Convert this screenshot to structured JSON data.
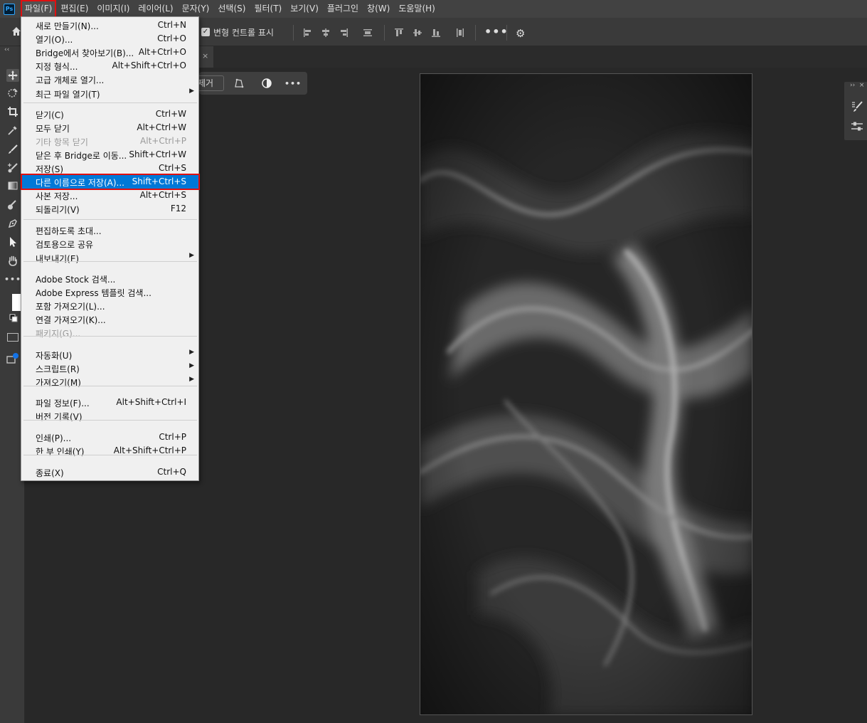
{
  "app": {
    "logo_text": "Ps"
  },
  "menubar": {
    "items": [
      {
        "label": "파일(F)"
      },
      {
        "label": "편집(E)"
      },
      {
        "label": "이미지(I)"
      },
      {
        "label": "레이어(L)"
      },
      {
        "label": "문자(Y)"
      },
      {
        "label": "선택(S)"
      },
      {
        "label": "필터(T)"
      },
      {
        "label": "보기(V)"
      },
      {
        "label": "플러그인"
      },
      {
        "label": "창(W)"
      },
      {
        "label": "도움말(H)"
      }
    ]
  },
  "optionsbar": {
    "transform_controls_label": "변형 컨트롤 표시",
    "transform_controls_checked": true,
    "more_icon": "ellipsis-icon",
    "settings_icon": "gear-icon"
  },
  "tab": {
    "close_glyph": "×"
  },
  "context_bar": {
    "remove_label": "제거"
  },
  "file_menu": {
    "items": [
      {
        "label": "새로 만들기(N)...",
        "shortcut": "Ctrl+N"
      },
      {
        "label": "열기(O)...",
        "shortcut": "Ctrl+O"
      },
      {
        "label": "Bridge에서 찾아보기(B)...",
        "shortcut": "Alt+Ctrl+O"
      },
      {
        "label": "지정 형식...",
        "shortcut": "Alt+Shift+Ctrl+O"
      },
      {
        "label": "고급 개체로 열기...",
        "shortcut": ""
      },
      {
        "label": "최근 파일 열기(T)",
        "shortcut": "",
        "submenu": true
      },
      {
        "label": "닫기(C)",
        "shortcut": "Ctrl+W"
      },
      {
        "label": "모두 닫기",
        "shortcut": "Alt+Ctrl+W"
      },
      {
        "label": "기타 항목 닫기",
        "shortcut": "Alt+Ctrl+P",
        "disabled": true
      },
      {
        "label": "닫은 후 Bridge로 이동...",
        "shortcut": "Shift+Ctrl+W"
      },
      {
        "label": "저장(S)",
        "shortcut": "Ctrl+S"
      },
      {
        "label": "다른 이름으로 저장(A)...",
        "shortcut": "Shift+Ctrl+S",
        "highlighted": true
      },
      {
        "label": "사본 저장...",
        "shortcut": "Alt+Ctrl+S"
      },
      {
        "label": "되돌리기(V)",
        "shortcut": "F12"
      },
      {
        "label": "편집하도록 초대...",
        "shortcut": ""
      },
      {
        "label": "검토용으로 공유",
        "shortcut": ""
      },
      {
        "label": "내보내기(E)",
        "shortcut": "",
        "submenu": true
      },
      {
        "label": "Adobe Stock 검색...",
        "shortcut": ""
      },
      {
        "label": "Adobe Express 템플릿 검색...",
        "shortcut": ""
      },
      {
        "label": "포함 가져오기(L)...",
        "shortcut": ""
      },
      {
        "label": "연결 가져오기(K)...",
        "shortcut": ""
      },
      {
        "label": "패키지(G)...",
        "shortcut": "",
        "disabled": true
      },
      {
        "label": "자동화(U)",
        "shortcut": "",
        "submenu": true
      },
      {
        "label": "스크립트(R)",
        "shortcut": "",
        "submenu": true
      },
      {
        "label": "가져오기(M)",
        "shortcut": "",
        "submenu": true
      },
      {
        "label": "파일 정보(F)...",
        "shortcut": "Alt+Shift+Ctrl+I"
      },
      {
        "label": "버전 기록(V)",
        "shortcut": ""
      },
      {
        "label": "인쇄(P)...",
        "shortcut": "Ctrl+P"
      },
      {
        "label": "한 부 인쇄(Y)",
        "shortcut": "Alt+Shift+Ctrl+P"
      },
      {
        "label": "종료(X)",
        "shortcut": "Ctrl+Q"
      }
    ],
    "submenu_glyph": "▶"
  },
  "colors": {
    "highlight": "#0078d7",
    "annotation_red": "#e01010",
    "menu_bg": "#f0f0f0"
  }
}
